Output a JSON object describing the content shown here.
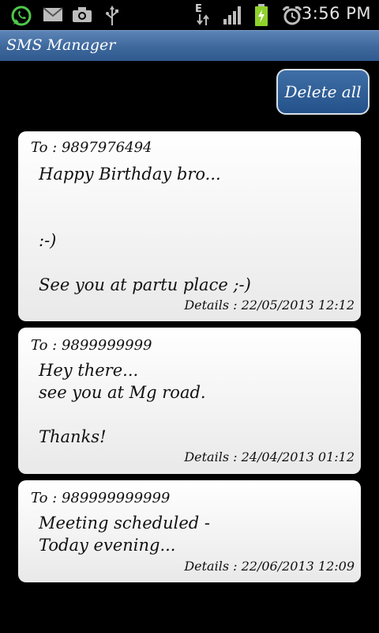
{
  "statusbar": {
    "time": "3:56 PM",
    "network_type": "E",
    "icons": [
      "whatsapp-icon",
      "gmail-icon",
      "camera-icon",
      "usb-icon",
      "data-arrows-icon",
      "signal-icon",
      "battery-icon",
      "alarm-icon"
    ]
  },
  "titlebar": {
    "title": "SMS Manager"
  },
  "toolbar": {
    "delete_all_label": "Delete all"
  },
  "messages": [
    {
      "to": "To : 9897976494",
      "body": "Happy Birthday bro...\n\n\n:-)\n\nSee you at partu place ;-)",
      "details": "Details : 22/05/2013 12:12"
    },
    {
      "to": "To : 9899999999",
      "body": "Hey there...\nsee you at Mg road.\n\nThanks!",
      "details": "Details : 24/04/2013 01:12"
    },
    {
      "to": "To : 989999999999",
      "body": "Meeting scheduled -\nToday evening...",
      "details": "Details : 22/06/2013 12:09"
    }
  ],
  "colors": {
    "background": "#000000",
    "titlebar": "#3e689c",
    "button": "#2a5a94",
    "card": "#f0f0f0"
  }
}
